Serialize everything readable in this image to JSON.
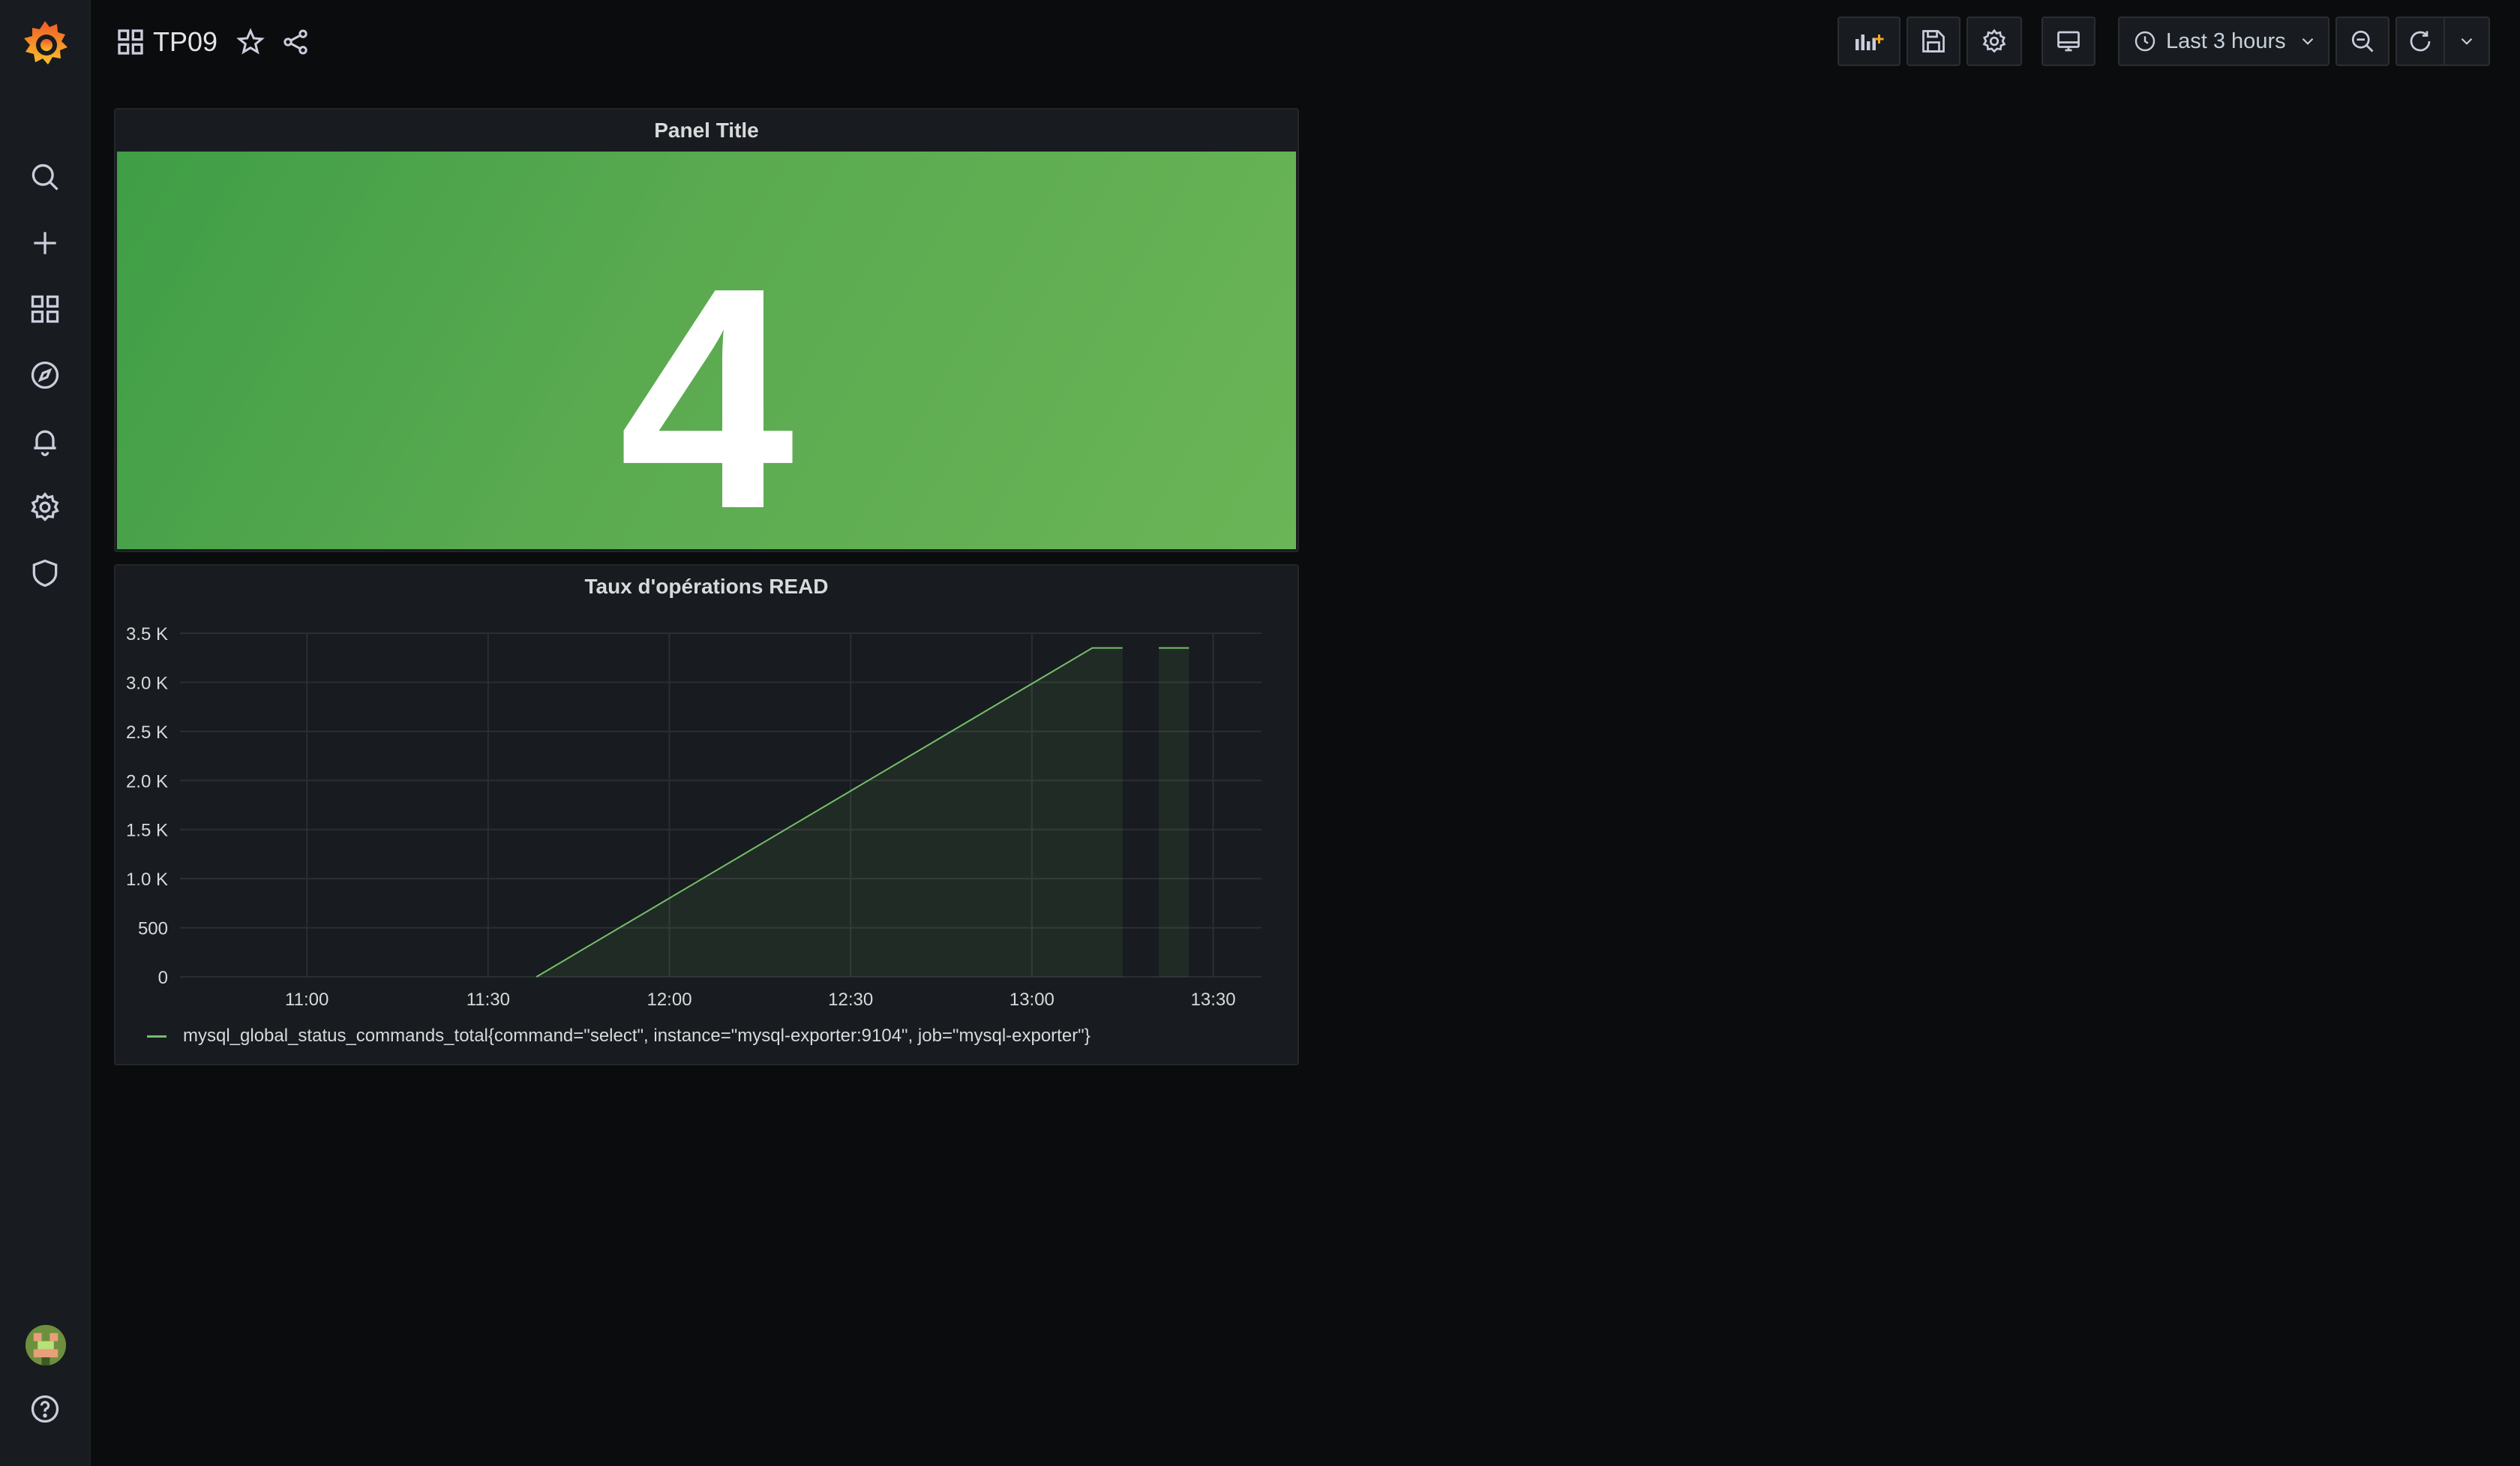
{
  "dashboard": {
    "title": "TP09"
  },
  "toolbar": {
    "time_range_label": "Last 3 hours",
    "add_panel": "add-panel-icon",
    "save": "save-icon",
    "settings": "gear-icon",
    "cycle_view": "monitor-icon",
    "zoom_out": "zoom-out-icon",
    "refresh": "refresh-icon",
    "refresh_interval": "chevron-down-icon"
  },
  "sidebar": {
    "items": [
      {
        "icon": "search-icon"
      },
      {
        "icon": "plus-icon"
      },
      {
        "icon": "dashboards-icon"
      },
      {
        "icon": "explore-compass-icon"
      },
      {
        "icon": "alerting-bell-icon"
      },
      {
        "icon": "configuration-gear-icon"
      },
      {
        "icon": "shield-icon"
      }
    ],
    "bottom": [
      {
        "icon": "avatar"
      },
      {
        "icon": "help-icon"
      }
    ]
  },
  "stat_panel": {
    "title": "Panel Title",
    "value": "4",
    "background_color": "#5aaa50"
  },
  "graph_panel": {
    "title": "Taux d'opérations READ",
    "legend": "mysql_global_status_commands_total{command=\"select\", instance=\"mysql-exporter:9104\", job=\"mysql-exporter\"}"
  },
  "chart_data": {
    "type": "area",
    "title": "Taux d'opérations READ",
    "xlabel": "",
    "ylabel": "",
    "x_ticks": [
      "11:00",
      "11:30",
      "12:00",
      "12:30",
      "13:00",
      "13:30"
    ],
    "y_ticks": [
      "0",
      "500",
      "1.0 K",
      "1.5 K",
      "2.0 K",
      "2.5 K",
      "3.0 K",
      "3.5 K"
    ],
    "ylim": [
      0,
      3500
    ],
    "xlim": [
      "10:39",
      "13:38"
    ],
    "grid": true,
    "legend_position": "bottom",
    "series": [
      {
        "name": "mysql_global_status_commands_total{command=\"select\", instance=\"mysql-exporter:9104\", job=\"mysql-exporter\"}",
        "color": "#73bf69",
        "segments": [
          [
            [
              "11:38",
              0
            ],
            [
              "13:10",
              3350
            ],
            [
              "13:15",
              3350
            ]
          ],
          [
            [
              "13:21",
              3350
            ],
            [
              "13:26",
              3350
            ]
          ]
        ]
      }
    ]
  }
}
